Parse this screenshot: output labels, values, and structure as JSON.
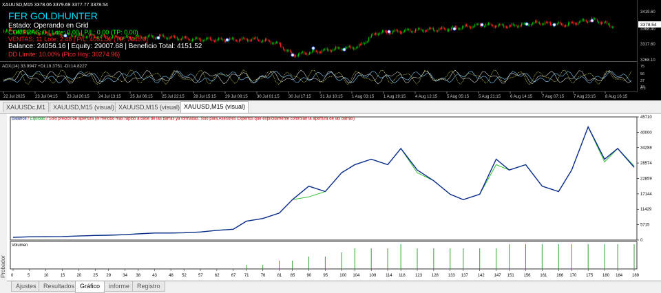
{
  "price_chart": {
    "header": "XAUUSD,M15 3378.06 3379.69 3377.77 3378.54",
    "ea_name": "FER GOLDHUNTER",
    "status": "Estado: Operando en Grid",
    "compras": "COMPRAS: 0 | Lote: 0.00 | P/L: 0.00 (TP: 0.00)",
    "ventas": "VENTAS: 11 Lote: 2.48 | P/L: 4051.52 (TP: 7448.0)",
    "balance_line": "Balance: 24056.16 | Equity: 29007.68 | Beneficio Total: 4151.52",
    "dd_line": "DD Limite: 10.00% (Pico Hoy: 30274.96)",
    "price_ticks": [
      "3419.60",
      "3368.40",
      "3317.60",
      "3268.10"
    ],
    "current_price": "3378.54",
    "indicator_label": "ADX(14) 33.9947 +DI:19.3751 -DI:14.8227",
    "indicator_ticks": [
      "75",
      "56",
      "37",
      "18",
      "0.0"
    ],
    "time_ticks": [
      "22 Jul 2025",
      "23 Jul 04:15",
      "23 Jul 20:15",
      "24 Jul 13:15",
      "25 Jul 06:15",
      "25 Jul 22:15",
      "28 Jul 15:15",
      "29 Jul 08:15",
      "30 Jul 01:15",
      "30 Jul 17:15",
      "31 Jul 10:15",
      "1 Aug 03:15",
      "1 Aug 19:15",
      "4 Aug 12:15",
      "5 Aug 05:15",
      "5 Aug 21:15",
      "6 Aug 14:15",
      "7 Aug 07:15",
      "7 Aug 23:15",
      "8 Aug 16:15"
    ],
    "colors": {
      "bull": "#00c000",
      "bear": "#ff2020",
      "ea_name": "#00e0ff",
      "status": "#ffffff",
      "compras": "#00ff00",
      "ventas": "#ff2020",
      "balance": "#ffffff",
      "dd": "#ff3030"
    }
  },
  "chart_tabs": [
    "XAUUSDc,M1",
    "XAUUSD,M15 (visual)",
    "XAUUSD,M15 (visual)",
    "XAUUSD,M15 (visual)"
  ],
  "tester": {
    "legend_balance": "Balance",
    "legend_sep": " / ",
    "legend_equity": "Equidad",
    "legend_note": " / Sólo precios de apertura (el método más rápido a base de las barras ya formadas. sólo para Asesores Expertos que explícitamente controlan la apertura de las barras)",
    "volume_label": "Volumen",
    "sidebar_label": "Probador"
  },
  "bottom_tabs": [
    "Ajustes",
    "Resultados",
    "Gráfico",
    "informe",
    "Registro"
  ],
  "chart_data": {
    "type": "line",
    "x": [
      0,
      5,
      10,
      15,
      20,
      25,
      29,
      34,
      38,
      43,
      48,
      52,
      57,
      62,
      67,
      71,
      76,
      81,
      85,
      90,
      95,
      100,
      104,
      109,
      114,
      118,
      123,
      128,
      133,
      137,
      142,
      147,
      151,
      156,
      161,
      166,
      170,
      175,
      180,
      184,
      189
    ],
    "x_ticks": [
      0,
      5,
      10,
      15,
      20,
      25,
      29,
      34,
      38,
      43,
      48,
      52,
      57,
      62,
      67,
      71,
      76,
      81,
      85,
      90,
      95,
      100,
      104,
      109,
      114,
      118,
      123,
      128,
      133,
      137,
      142,
      147,
      151,
      156,
      161,
      166,
      170,
      175,
      180,
      184,
      189
    ],
    "ylim": [
      0,
      45710
    ],
    "y_ticks": [
      0,
      5715,
      11429,
      17144,
      22859,
      28574,
      34288,
      40000,
      45710
    ],
    "series": [
      {
        "name": "Balance",
        "color": "#0a2a8c",
        "values": [
          1000,
          1200,
          1250,
          1300,
          1500,
          1700,
          1800,
          2000,
          2300,
          2600,
          2600,
          2700,
          3000,
          3600,
          4000,
          7000,
          8000,
          10000,
          15000,
          20000,
          18000,
          25000,
          28000,
          30000,
          28000,
          34000,
          26000,
          22000,
          17000,
          15000,
          17000,
          30000,
          26000,
          28000,
          20000,
          18000,
          26000,
          42000,
          30000,
          34000,
          27000
        ]
      },
      {
        "name": "Equidad",
        "color": "#30c030",
        "values": [
          1000,
          1200,
          1250,
          1300,
          1500,
          1700,
          1800,
          2000,
          2300,
          2600,
          2600,
          2700,
          3000,
          3600,
          4000,
          7000,
          8000,
          10000,
          15000,
          16000,
          18000,
          25000,
          28000,
          30000,
          28000,
          34000,
          25000,
          22000,
          17000,
          15000,
          17000,
          28000,
          26000,
          28000,
          20000,
          18000,
          26000,
          42000,
          29000,
          34000,
          27500
        ]
      }
    ],
    "volume": [
      0,
      0,
      0,
      0,
      0,
      0,
      0,
      0,
      0,
      0,
      0,
      0,
      0,
      0,
      0,
      1,
      1,
      2,
      2,
      3,
      3,
      4,
      5,
      5,
      5,
      6,
      5,
      5,
      5,
      5,
      5,
      5,
      6,
      6,
      6,
      6,
      6,
      6,
      6,
      6,
      6
    ]
  }
}
